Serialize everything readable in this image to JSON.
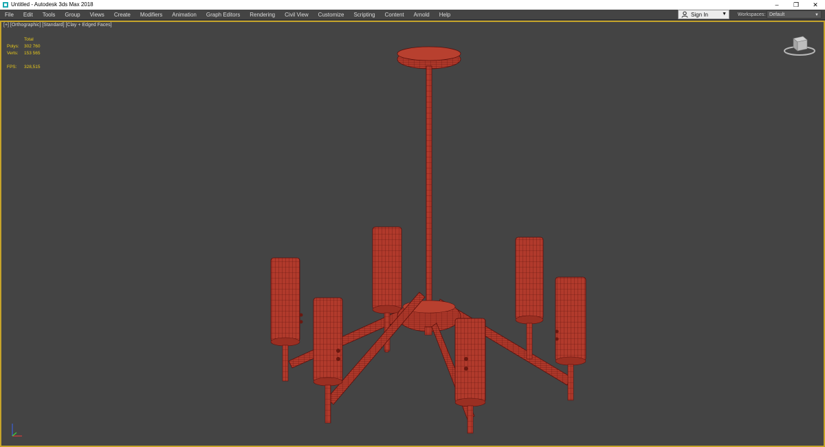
{
  "window": {
    "title": "Untitled - Autodesk 3ds Max 2018",
    "min": "–",
    "restore": "❐",
    "close": "✕"
  },
  "menu": [
    "File",
    "Edit",
    "Tools",
    "Group",
    "Views",
    "Create",
    "Modifiers",
    "Animation",
    "Graph Editors",
    "Rendering",
    "Civil View",
    "Customize",
    "Scripting",
    "Content",
    "Arnold",
    "Help"
  ],
  "account": {
    "signin": "Sign In"
  },
  "workspaces": {
    "label": "Workspaces:",
    "value": "Default"
  },
  "viewport": {
    "label": "[+] [Orthographic] [Standard] [Clay + Edged Faces]",
    "stats": {
      "header": "Total",
      "polys_label": "Polys:",
      "polys": "302 760",
      "verts_label": "Verts:",
      "verts": "153 565",
      "fps_label": "FPS:",
      "fps": "328,515"
    }
  },
  "colors": {
    "accent": "#c6a42a",
    "stats": "#e8c81a",
    "model": "#b13a2c",
    "wire": "#5a100c"
  }
}
